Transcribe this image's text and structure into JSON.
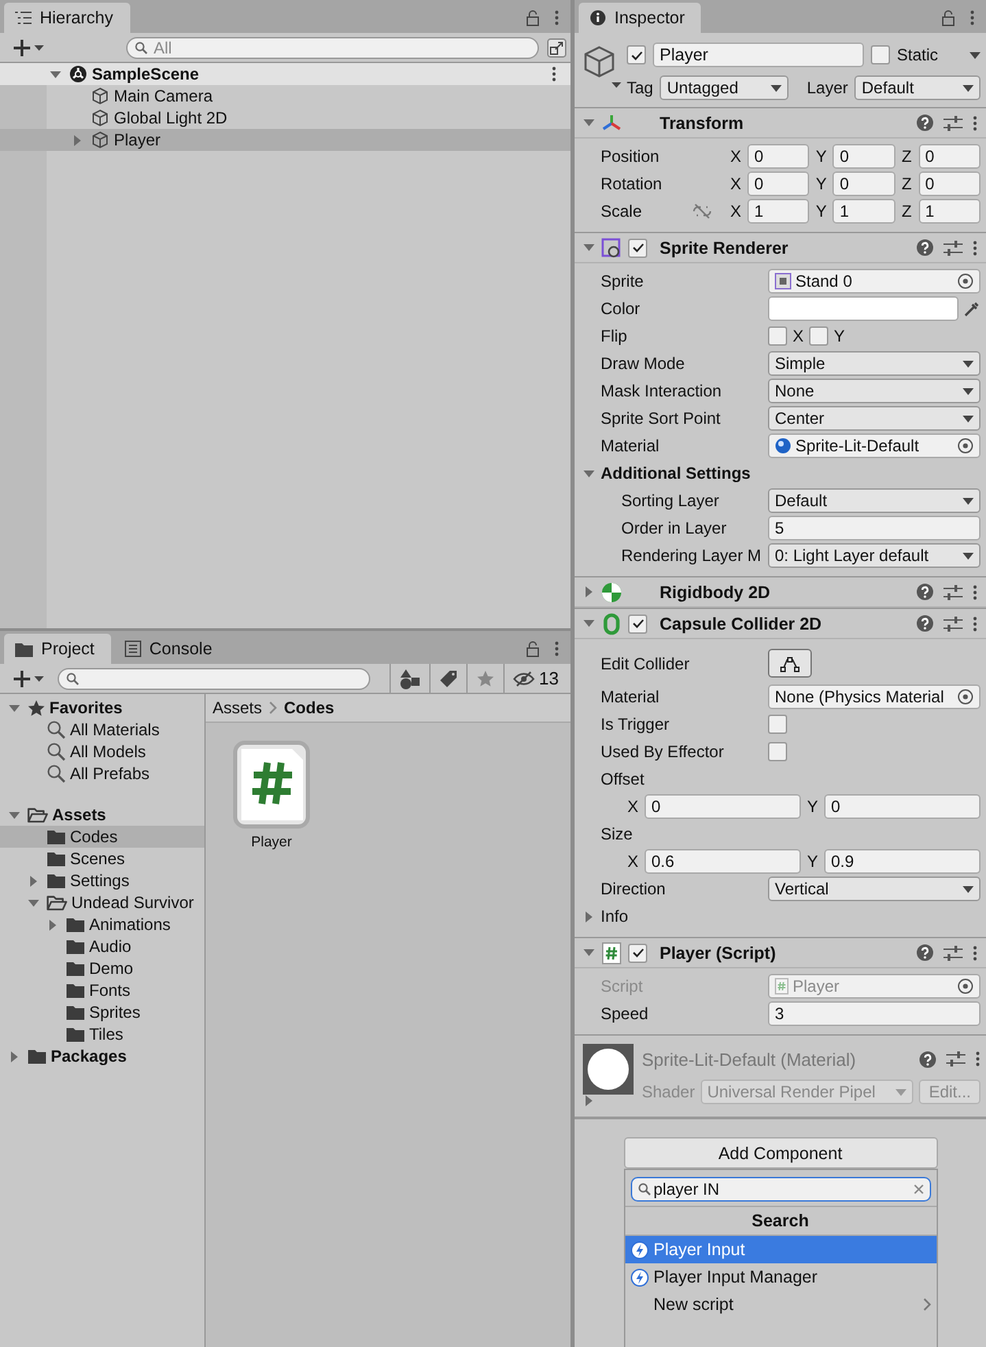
{
  "hierarchy": {
    "title": "Hierarchy",
    "search": {
      "placeholder": "All"
    },
    "tree": [
      {
        "label": "SampleScene",
        "kind": "scene",
        "expanded": true,
        "selected": false,
        "children": [
          {
            "label": "Main Camera",
            "kind": "object",
            "selected": false
          },
          {
            "label": "Global Light 2D",
            "kind": "object",
            "selected": false
          },
          {
            "label": "Player",
            "kind": "object",
            "expanded": false,
            "selected": true
          }
        ]
      }
    ]
  },
  "project": {
    "tabs": [
      {
        "label": "Project",
        "kind": "project",
        "selected": true
      },
      {
        "label": "Console",
        "kind": "console",
        "selected": false
      }
    ],
    "hidden_count": "13",
    "tree": [
      {
        "label": "Favorites",
        "kind": "favorites",
        "expanded": true,
        "children": [
          {
            "label": "All Materials",
            "kind": "search",
            "selected": false
          },
          {
            "label": "All Models",
            "kind": "search",
            "selected": false
          },
          {
            "label": "All Prefabs",
            "kind": "search",
            "selected": false
          }
        ]
      },
      {
        "label": "Assets",
        "kind": "root",
        "expanded": true,
        "selected": false,
        "children": [
          {
            "label": "Codes",
            "kind": "folder",
            "selected": true
          },
          {
            "label": "Scenes",
            "kind": "folder",
            "selected": false
          },
          {
            "label": "Settings",
            "kind": "folder",
            "expanded": false,
            "selected": false
          },
          {
            "label": "Undead Survivor",
            "kind": "folder",
            "expanded": true,
            "selected": false,
            "children": [
              {
                "label": "Animations",
                "kind": "folder",
                "expanded": false,
                "selected": false
              },
              {
                "label": "Audio",
                "kind": "folder",
                "selected": false
              },
              {
                "label": "Demo",
                "kind": "folder",
                "selected": false
              },
              {
                "label": "Fonts",
                "kind": "folder",
                "selected": false
              },
              {
                "label": "Sprites",
                "kind": "folder",
                "selected": false
              },
              {
                "label": "Tiles",
                "kind": "folder",
                "selected": false
              }
            ]
          }
        ]
      },
      {
        "label": "Packages",
        "kind": "root",
        "expanded": false,
        "selected": false
      }
    ],
    "breadcrumb": [
      "Assets",
      "Codes"
    ],
    "files": [
      {
        "name": "Player",
        "kind": "script"
      }
    ]
  },
  "inspector": {
    "title": "Inspector",
    "object": {
      "name": "Player",
      "active": true,
      "static_label": "Static",
      "static": false,
      "tag_label": "Tag",
      "tag": "Untagged",
      "layer_label": "Layer",
      "layer": "Default"
    },
    "components": [
      {
        "kind": "transform",
        "title": "Transform",
        "expanded": true,
        "rows": [
          {
            "label": "Position",
            "fields": [
              {
                "axis": "X",
                "value": "0"
              },
              {
                "axis": "Y",
                "value": "0"
              },
              {
                "axis": "Z",
                "value": "0"
              }
            ]
          },
          {
            "label": "Rotation",
            "fields": [
              {
                "axis": "X",
                "value": "0"
              },
              {
                "axis": "Y",
                "value": "0"
              },
              {
                "axis": "Z",
                "value": "0"
              }
            ]
          },
          {
            "label": "Scale",
            "constrain": false,
            "fields": [
              {
                "axis": "X",
                "value": "1"
              },
              {
                "axis": "Y",
                "value": "1"
              },
              {
                "axis": "Z",
                "value": "1"
              }
            ]
          }
        ]
      },
      {
        "kind": "sprite_renderer",
        "title": "Sprite Renderer",
        "expanded": true,
        "enabled": true,
        "properties": [
          {
            "kind": "object",
            "label": "Sprite",
            "value": {
              "kind": "sprite",
              "text": "Stand 0"
            }
          },
          {
            "kind": "color",
            "label": "Color",
            "color": "#ffffff"
          },
          {
            "kind": "flip",
            "label": "Flip",
            "values": [
              {
                "label": "X",
                "checked": false
              },
              {
                "label": "Y",
                "checked": false
              }
            ]
          },
          {
            "kind": "dropdown",
            "label": "Draw Mode",
            "value": "Simple"
          },
          {
            "kind": "dropdown",
            "label": "Mask Interaction",
            "value": "None"
          },
          {
            "kind": "dropdown",
            "label": "Sprite Sort Point",
            "value": "Center"
          },
          {
            "kind": "object",
            "label": "Material",
            "value": {
              "kind": "material",
              "text": "Sprite-Lit-Default"
            }
          },
          {
            "kind": "section",
            "label": "Additional Settings",
            "expanded": true,
            "children": [
              {
                "kind": "dropdown",
                "label": "Sorting Layer",
                "value": "Default"
              },
              {
                "kind": "text",
                "label": "Order in Layer",
                "value": "5"
              },
              {
                "kind": "dropdown",
                "label": "Rendering Layer M",
                "value": "0: Light Layer default"
              }
            ]
          }
        ]
      },
      {
        "kind": "rigidbody",
        "title": "Rigidbody 2D",
        "expanded": false
      },
      {
        "kind": "collider",
        "title": "Capsule Collider 2D",
        "expanded": true,
        "enabled": true,
        "properties": [
          {
            "kind": "button",
            "label": "Edit Collider"
          },
          {
            "kind": "object",
            "label": "Material",
            "value": {
              "text": "None (Physics Material"
            }
          },
          {
            "kind": "checkbox",
            "label": "Is Trigger",
            "checked": false
          },
          {
            "kind": "checkbox",
            "label": "Used By Effector",
            "checked": false
          },
          {
            "kind": "vector2",
            "label": "Offset",
            "values": [
              {
                "axis": "X",
                "value": "0"
              },
              {
                "axis": "Y",
                "value": "0"
              }
            ]
          },
          {
            "kind": "vector2",
            "label": "Size",
            "values": [
              {
                "axis": "X",
                "value": "0.6"
              },
              {
                "axis": "Y",
                "value": "0.9"
              }
            ]
          },
          {
            "kind": "dropdown",
            "label": "Direction",
            "value": "Vertical"
          },
          {
            "kind": "foldout",
            "label": "Info",
            "expanded": false
          }
        ]
      },
      {
        "kind": "script",
        "title": "Player (Script)",
        "expanded": true,
        "enabled": true,
        "properties": [
          {
            "kind": "object",
            "label": "Script",
            "value": {
              "kind": "script",
              "text": "Player"
            },
            "disabled": true
          },
          {
            "kind": "text",
            "label": "Speed",
            "value": "3",
            "disabled": false
          }
        ]
      },
      {
        "kind": "material",
        "title": "Sprite-Lit-Default (Material)",
        "expanded": false,
        "shader_label": "Shader",
        "shader": "Universal Render Pipel",
        "edit": "Edit..."
      }
    ],
    "add_component": {
      "label": "Add Component",
      "search": "player IN",
      "header": "Search",
      "items": [
        {
          "label": "Player Input",
          "kind": "input",
          "selected": true
        },
        {
          "label": "Player Input Manager",
          "kind": "input",
          "selected": false
        },
        {
          "label": "New script",
          "kind": "submenu",
          "selected": false
        }
      ]
    }
  }
}
